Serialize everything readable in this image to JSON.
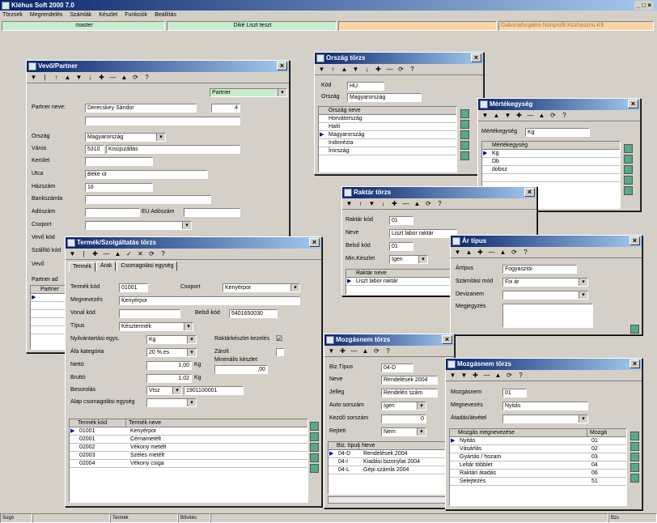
{
  "app": {
    "title": "Kléhus Soft 2000 7.0",
    "win_controls": "_ □ ×"
  },
  "menu": [
    "Törzsek",
    "Megrendelés",
    "Számlák",
    "Készlet",
    "Funkciók",
    "Beállítás"
  ],
  "topbar": {
    "user": "master",
    "db": "Diké Liszt teszt",
    "empty": "",
    "company": "Gabonaforgalmi Nonprofit Közhasznú Kft"
  },
  "statusbar": [
    "Súgó",
    "",
    "Termék",
    "Bővítés",
    "",
    "Bzs"
  ],
  "toolbar_glyphs": [
    "▼",
    "|",
    "↑",
    "▲",
    "▼",
    "↓",
    "✚",
    "—",
    "▲",
    "✓",
    "✕",
    "⟳",
    "?"
  ],
  "partner": {
    "title": "Vevő/Partner",
    "dropdown": "Partner",
    "labels": [
      "Partner neve:",
      "Ország",
      "Város",
      "Kerület",
      "Utca",
      "Házszám",
      "Bankszámla",
      "Adószám",
      "Csoport",
      "Vevő kód",
      "Szállító kód",
      "Vevő",
      "Partner ad"
    ],
    "name": "Derecskey Sándor",
    "num": "4",
    "country": "Magyarország",
    "zip": "5310",
    "city": "Kisújszállás",
    "street": "Béke út",
    "house": "16",
    "eu_label": "EU Adószám",
    "grid_header": "Partner"
  },
  "orszag": {
    "title": "Ország törzs",
    "kod_label": "Kód",
    "kod": "HU",
    "orszag_label": "Ország",
    "orszag": "Magyarország",
    "col": "Ország neve",
    "rows": [
      "Horvátország",
      "Haiti",
      "Magyarország",
      "Indonézia",
      "Írország"
    ]
  },
  "mertek": {
    "title": "Mértékegység",
    "label": "Mértékegység",
    "value": "Kg",
    "col": "Mértékegység",
    "rows": [
      "Kg",
      "Db",
      "doboz"
    ]
  },
  "raktar": {
    "title": "Raktár törzs",
    "labels": [
      "Raktár kód",
      "Neve",
      "Belső kód",
      "Min.Készlet"
    ],
    "kod": "01",
    "neve": "Liszt labor raktár",
    "belso": "01",
    "min": "Igen",
    "col": "Raktár neve",
    "rows": [
      "Liszt labor raktár"
    ]
  },
  "ar": {
    "title": "Ár típus",
    "labels": [
      "Ártípus",
      "Számítási mód",
      "Devizanem",
      "Megjegyzés"
    ],
    "artipus": "Fogyasztói",
    "szamitas": "Fix ár",
    "deviza": ""
  },
  "termek": {
    "title": "Termék/Szolgáltatás törzs",
    "tabs": [
      "Termék",
      "Árak",
      "Csomagolási egység"
    ],
    "kod_label": "Termék kód",
    "kod": "01001",
    "csoport_label": "Csoport",
    "csoport": "Kenyérpor",
    "megnev_label": "Megnevezés",
    "megnev": "Kenyérpor",
    "vonal_label": "Vonal kód",
    "belso_label": "Belső kód",
    "belso": "5401650030",
    "tipus_label": "Típus",
    "tipus": "Késztermék",
    "nyilv_label": "Nyilvántartási egys.",
    "nyilv": "Kg",
    "rakt_label": "Raktárkészlet kezelés",
    "rakt_check": "☑",
    "afa_label": "Áfa kategória",
    "afa": "20 % es",
    "zarolt_label": "Zárolt",
    "netto_label": "Nettó",
    "netto": "1,00",
    "netto_unit": "Kg",
    "min_label": "Minimális készlet",
    "min": ",00",
    "brutto_label": "Bruttó",
    "brutto": "1,02",
    "brutto_unit": "Kg",
    "besorolas_label": "Besorolás",
    "besorolas": "Vtsz",
    "besorolas_val": "1901100001",
    "alap_label": "Alap csomagolási egység",
    "cols": [
      "Termék kód",
      "Termék neve"
    ],
    "rows": [
      [
        "01001",
        "Kenyérpor"
      ],
      [
        "02001",
        "Cérnametélt"
      ],
      [
        "02002",
        "Vékony metélt"
      ],
      [
        "02003",
        "Széles metélt"
      ],
      [
        "02004",
        "Vékony csiga"
      ]
    ]
  },
  "mozgnem": {
    "title": "Mozgásnem törzs",
    "labels": [
      "Biz.Típus",
      "Neve",
      "Jelleg",
      "Auto sorszám",
      "Kezdő sorszám",
      "Rejtett"
    ],
    "tipus": "04-D",
    "neve": "Rendelések 2004",
    "jelleg": "Rendelés szám",
    "auto": "Igen",
    "kezdo": "0",
    "rejtett": "Nem",
    "cols": [
      "Biz. típus",
      "Neve"
    ],
    "rows": [
      [
        "04-D",
        "Rendelések 2004"
      ],
      [
        "04-I",
        "Kiadási bizonylat 2004"
      ],
      [
        "04-L",
        "Gépi számla 2004"
      ]
    ]
  },
  "mozgasnem": {
    "title": "Mozgásnem törzs",
    "labels": [
      "Mozgásnem",
      "Megnevezés",
      "Átadás/átvétel"
    ],
    "kod": "01",
    "megnev": "Nyitás",
    "cols": [
      "Mozgás megnevezése",
      "Mozgá"
    ],
    "rows": [
      [
        "Nyitás",
        "01"
      ],
      [
        "Vásárlás",
        "02"
      ],
      [
        "Gyártás / hozam",
        "03"
      ],
      [
        "Leltár többlet",
        "04"
      ],
      [
        "Raktári átadás",
        "06"
      ],
      [
        "Selejtezés",
        "51"
      ]
    ]
  }
}
